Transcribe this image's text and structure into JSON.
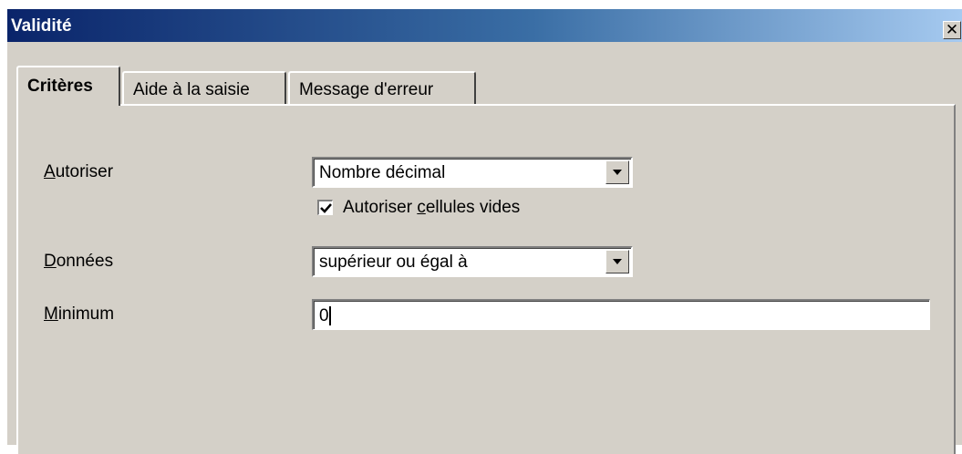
{
  "window": {
    "title": "Validité",
    "close_icon": "close-icon"
  },
  "tabs": [
    {
      "label": "Critères",
      "active": true
    },
    {
      "label": "Aide à la saisie",
      "active": false
    },
    {
      "label": "Message d'erreur",
      "active": false
    }
  ],
  "form": {
    "allow": {
      "label_mnemonic": "A",
      "label_rest": "utoriser",
      "value": "Nombre décimal"
    },
    "allow_empty": {
      "label_before": "Autoriser ",
      "label_mnemonic": "c",
      "label_after": "ellules vides",
      "checked": true
    },
    "data": {
      "label_mnemonic": "D",
      "label_rest": "onnées",
      "value": "supérieur ou égal à"
    },
    "minimum": {
      "label_mnemonic": "M",
      "label_rest": "inimum",
      "value": "0"
    }
  },
  "colors": {
    "title_gradient_start": "#0a246a",
    "title_gradient_end": "#a6caf0",
    "face": "#d4d0c8"
  }
}
